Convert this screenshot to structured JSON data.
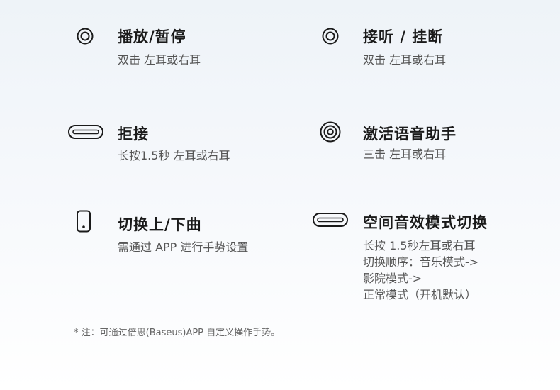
{
  "features": [
    {
      "title": "播放/暂停",
      "desc": [
        "双击 左耳或右耳"
      ],
      "icon": "double-circle-icon"
    },
    {
      "title": "接听 / 挂断",
      "desc": [
        "双击 左耳或右耳"
      ],
      "icon": "double-circle-icon"
    },
    {
      "title": "拒接",
      "desc": [
        "长按1.5秒 左耳或右耳"
      ],
      "icon": "capsule-icon"
    },
    {
      "title": "激活语音助手",
      "desc": [
        "三击 左耳或右耳"
      ],
      "icon": "triple-circle-icon"
    },
    {
      "title": "切换上/下曲",
      "desc": [
        "需通过 APP 进行手势设置"
      ],
      "icon": "phone-icon"
    },
    {
      "title": "空间音效模式切换",
      "desc": [
        "长按 1.5秒左耳或右耳",
        "切换顺序：音乐模式->",
        "影院模式->",
        "正常模式（开机默认）"
      ],
      "icon": "capsule-icon"
    }
  ],
  "note": "* 注：可通过倍思(Baseus)APP 自定义操作手势。"
}
